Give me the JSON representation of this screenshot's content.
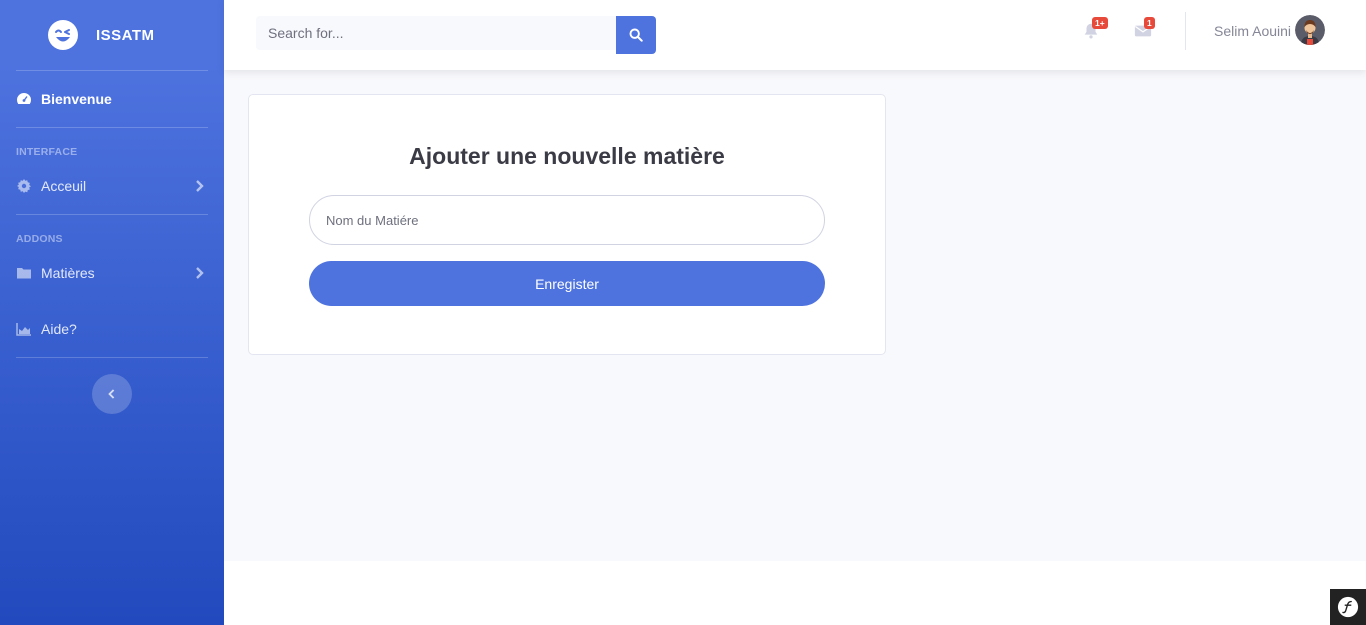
{
  "sidebar": {
    "brand": "ISSATM",
    "active_item": "Bienvenue",
    "sections": [
      {
        "heading": "INTERFACE",
        "item": "Acceuil"
      },
      {
        "heading": "ADDONS",
        "item": "Matières"
      }
    ],
    "help_item": "Aide?"
  },
  "topbar": {
    "search_placeholder": "Search for...",
    "alerts_badge": "1+",
    "messages_badge": "1",
    "user_name": "Selim Aouini"
  },
  "form": {
    "title": "Ajouter une nouvelle matière",
    "field_placeholder": "Nom du Matiére",
    "submit_label": "Enregister"
  },
  "colors": {
    "primary": "#4e73df",
    "danger": "#e74a3b"
  }
}
